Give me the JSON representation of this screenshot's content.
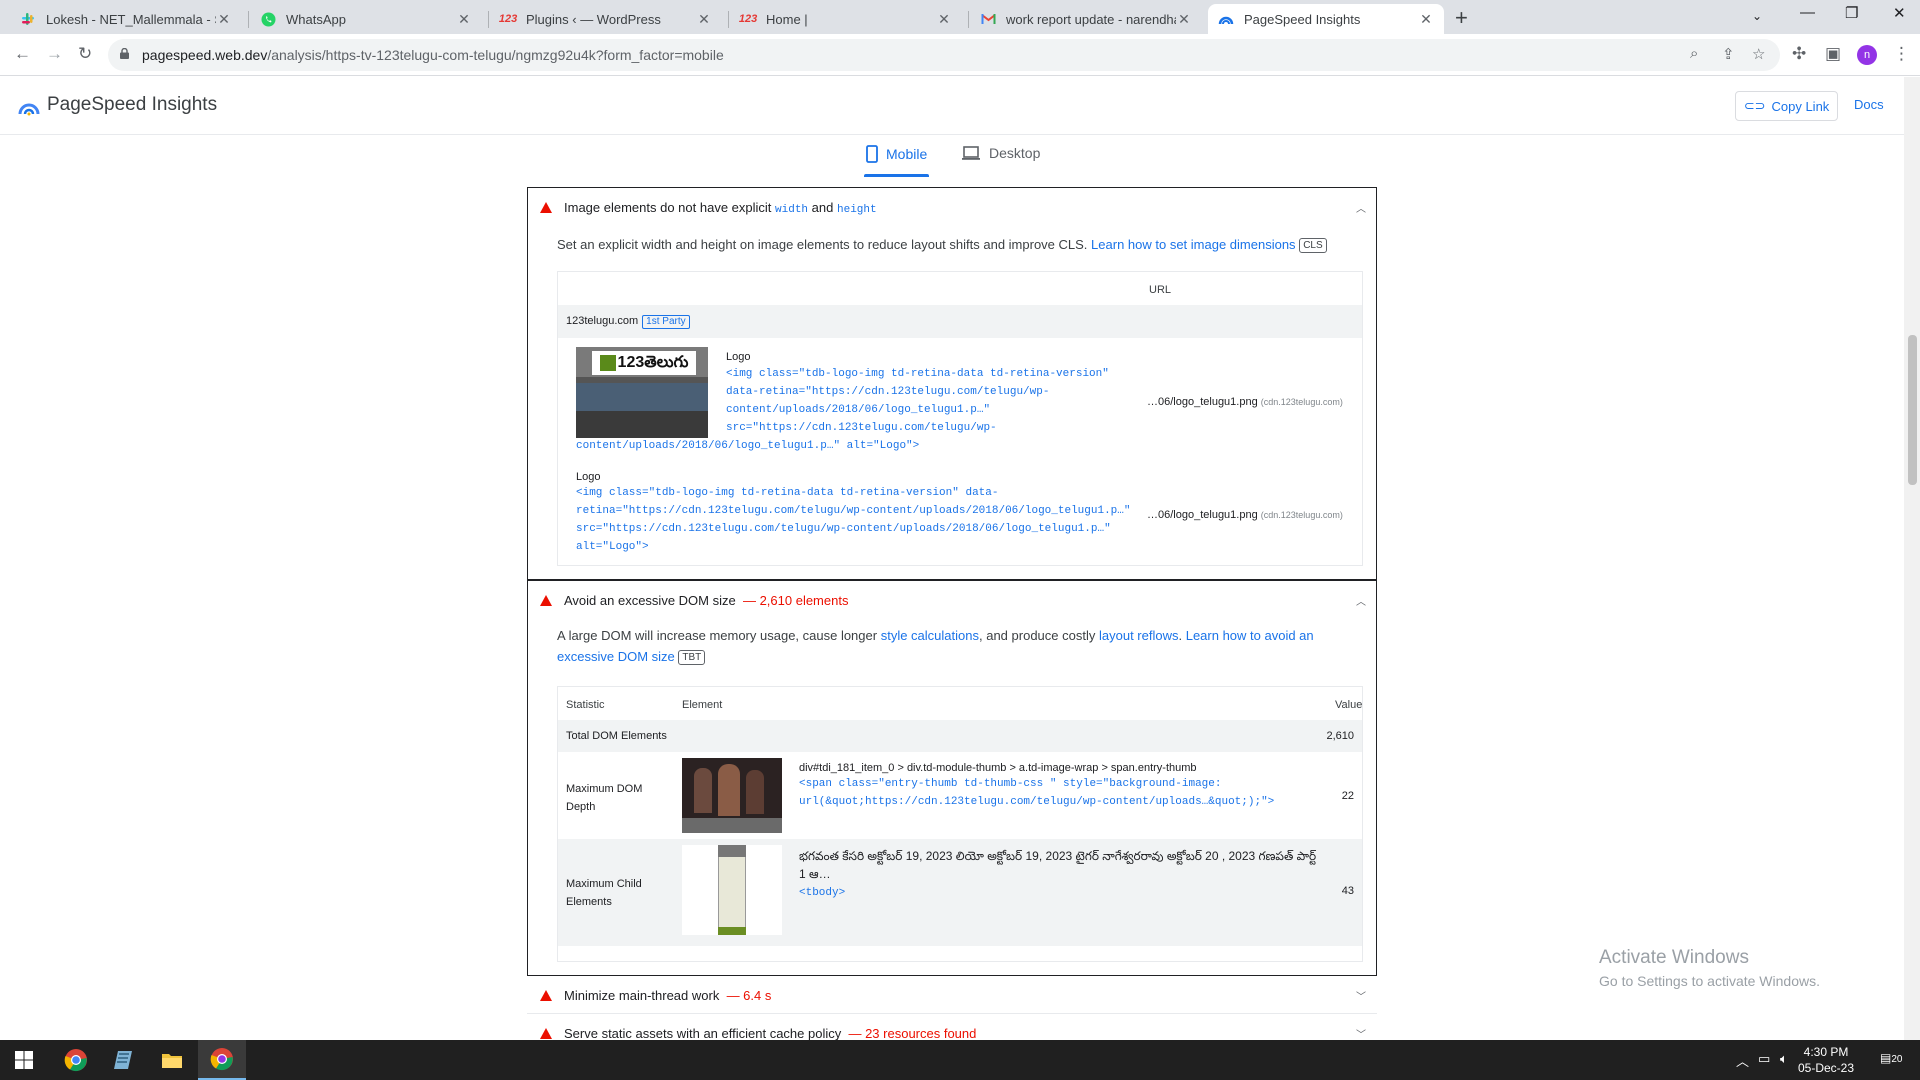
{
  "browser": {
    "tabs": [
      {
        "title": "Lokesh - NET_Mallemmala - Slac",
        "icon": "slack-icon"
      },
      {
        "title": "WhatsApp",
        "icon": "whatsapp-icon"
      },
      {
        "title": "Plugins ‹ — WordPress",
        "icon": "123-icon"
      },
      {
        "title": "Home |",
        "icon": "123-icon"
      },
      {
        "title": "work report update - narendhar",
        "icon": "gmail-icon"
      },
      {
        "title": "PageSpeed Insights",
        "icon": "pagespeed-icon"
      }
    ],
    "url_host": "pagespeed.web.dev",
    "url_path": "/analysis/https-tv-123telugu-com-telugu/ngmzg92u4k?form_factor=mobile",
    "profile_initial": "n"
  },
  "psi": {
    "title": "PageSpeed Insights",
    "copy_link": "Copy Link",
    "docs": "Docs",
    "tab_mobile": "Mobile",
    "tab_desktop": "Desktop"
  },
  "audit1": {
    "title_pre": "Image elements do not have explicit",
    "code_width": "width",
    "title_and": "and",
    "code_height": "height",
    "desc": "Set an explicit width and height on image elements to reduce layout shifts and improve CLS.",
    "learn": "Learn how to set image dimensions",
    "chip": "CLS",
    "col_url": "URL",
    "group": "123telugu.com",
    "party": "1st Party",
    "items": [
      {
        "label": "Logo",
        "code1": "<img class=\"tdb-logo-img td-retina-data td-retina-version\"",
        "code2": "data-retina=\"https://cdn.123telugu.com/telugu/wp-",
        "code3": "content/uploads/2018/06/logo_telugu1.p…\"",
        "code4": "src=\"https://cdn.123telugu.com/telugu/wp-",
        "code5": "content/uploads/2018/06/logo_telugu1.p…\" alt=\"Logo\">",
        "url": "…06/logo_telugu1.png",
        "domain": "(cdn.123telugu.com)"
      },
      {
        "label": "Logo",
        "code1": "<img class=\"tdb-logo-img td-retina-data td-retina-version\" data-",
        "code2": "retina=\"https://cdn.123telugu.com/telugu/wp-content/uploads/2018/06/logo_telugu1.p…\"",
        "code3": "src=\"https://cdn.123telugu.com/telugu/wp-content/uploads/2018/06/logo_telugu1.p…\"",
        "code4": "alt=\"Logo\">",
        "url": "…06/logo_telugu1.png",
        "domain": "(cdn.123telugu.com)"
      }
    ],
    "logo_text": "123తెలుగు"
  },
  "audit2": {
    "title": "Avoid an excessive DOM size",
    "value": "— 2,610 elements",
    "desc_pre": "A large DOM will increase memory usage, cause longer",
    "link1": "style calculations",
    "desc_mid": ", and produce costly",
    "link2": "layout reflows",
    "desc_dot": ".",
    "learn": "Learn how to avoid an excessive DOM size",
    "chip": "TBT",
    "col_stat": "Statistic",
    "col_elem": "Element",
    "col_val": "Value",
    "rows": [
      {
        "stat": "Total DOM Elements",
        "value": "2,610"
      },
      {
        "stat": "Maximum DOM Depth",
        "selector": "div#tdi_181_item_0 > div.td-module-thumb > a.td-image-wrap > span.entry-thumb",
        "code1": "<span class=\"entry-thumb td-thumb-css \" style=\"background-image:",
        "code2": "url(&quot;https://cdn.123telugu.com/telugu/wp-content/uploads…&quot;);\">",
        "value": "22"
      },
      {
        "stat": "Maximum Child Elements",
        "text1": "భగవంత కేసరి అక్టోబర్ 19, 2023 లియో అక్టోబర్ 19, 2023 టైగర్ నాగేశ్వరరావు అక్టోబర్ 20 , 2023 గణపత్ పార్ట్",
        "text2": "1 ఆ…",
        "code1": "<tbody>",
        "value": "43"
      }
    ]
  },
  "audit3": {
    "title": "Minimize main-thread work",
    "value": "— 6.4 s"
  },
  "audit4": {
    "title": "Serve static assets with an efficient cache policy",
    "value": "— 23 resources found"
  },
  "watermark": {
    "line1": "Activate Windows",
    "line2": "Go to Settings to activate Windows."
  },
  "taskbar": {
    "time": "4:30 PM",
    "date": "05-Dec-23",
    "notif": "20"
  }
}
